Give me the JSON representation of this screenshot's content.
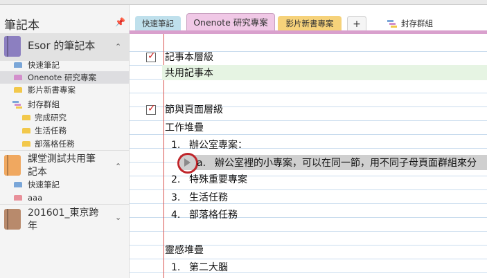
{
  "sidebar": {
    "title": "筆記本",
    "notebooks": [
      {
        "name": "Esor 的筆記本",
        "color": "#8c7fc0",
        "sections": [
          {
            "label": "快速筆記",
            "color": "#7aa6d8"
          },
          {
            "label": "Onenote 研究專案",
            "color": "#d38fcc",
            "active": true
          },
          {
            "label": "影片新書專案",
            "color": "#f2c84b"
          }
        ],
        "group": {
          "label": "封存群組",
          "sections": [
            {
              "label": "完成研究",
              "color": "#f2c84b"
            },
            {
              "label": "生活任務",
              "color": "#f2c84b"
            },
            {
              "label": "部落格任務",
              "color": "#f2c84b"
            }
          ]
        }
      },
      {
        "name_line1": "課堂測試共用筆",
        "name_line2": "記本",
        "color": "#f0a860",
        "sections": [
          {
            "label": "快速筆記",
            "color": "#7aa6d8"
          },
          {
            "label": "aaa",
            "color": "#e8909a"
          }
        ]
      },
      {
        "name_line1": "201601_東京跨",
        "name_line2": "年",
        "color": "#b88a6c"
      }
    ]
  },
  "tabs": {
    "items": [
      "快速筆記",
      "Onenote 研究專案",
      "影片新書專案"
    ],
    "add_label": "+",
    "archive_label": "封存群組"
  },
  "page": {
    "line1": "記事本層級",
    "line2": "共用記事本",
    "line3": "節與頁面層級",
    "line4": "工作堆疊",
    "list1": [
      {
        "n": "1.",
        "text": "辦公室專案："
      },
      {
        "n": "2.",
        "text": "特殊重要專案"
      },
      {
        "n": "3.",
        "text": "生活任務"
      },
      {
        "n": "4.",
        "text": "部落格任務"
      }
    ],
    "sub_n": "a.",
    "sub_text": "辦公室裡的小專案，可以在同一節，用不同子母頁面群組來分",
    "line5": "靈感堆疊",
    "list2": [
      {
        "n": "1.",
        "text": "第二大腦"
      }
    ]
  }
}
